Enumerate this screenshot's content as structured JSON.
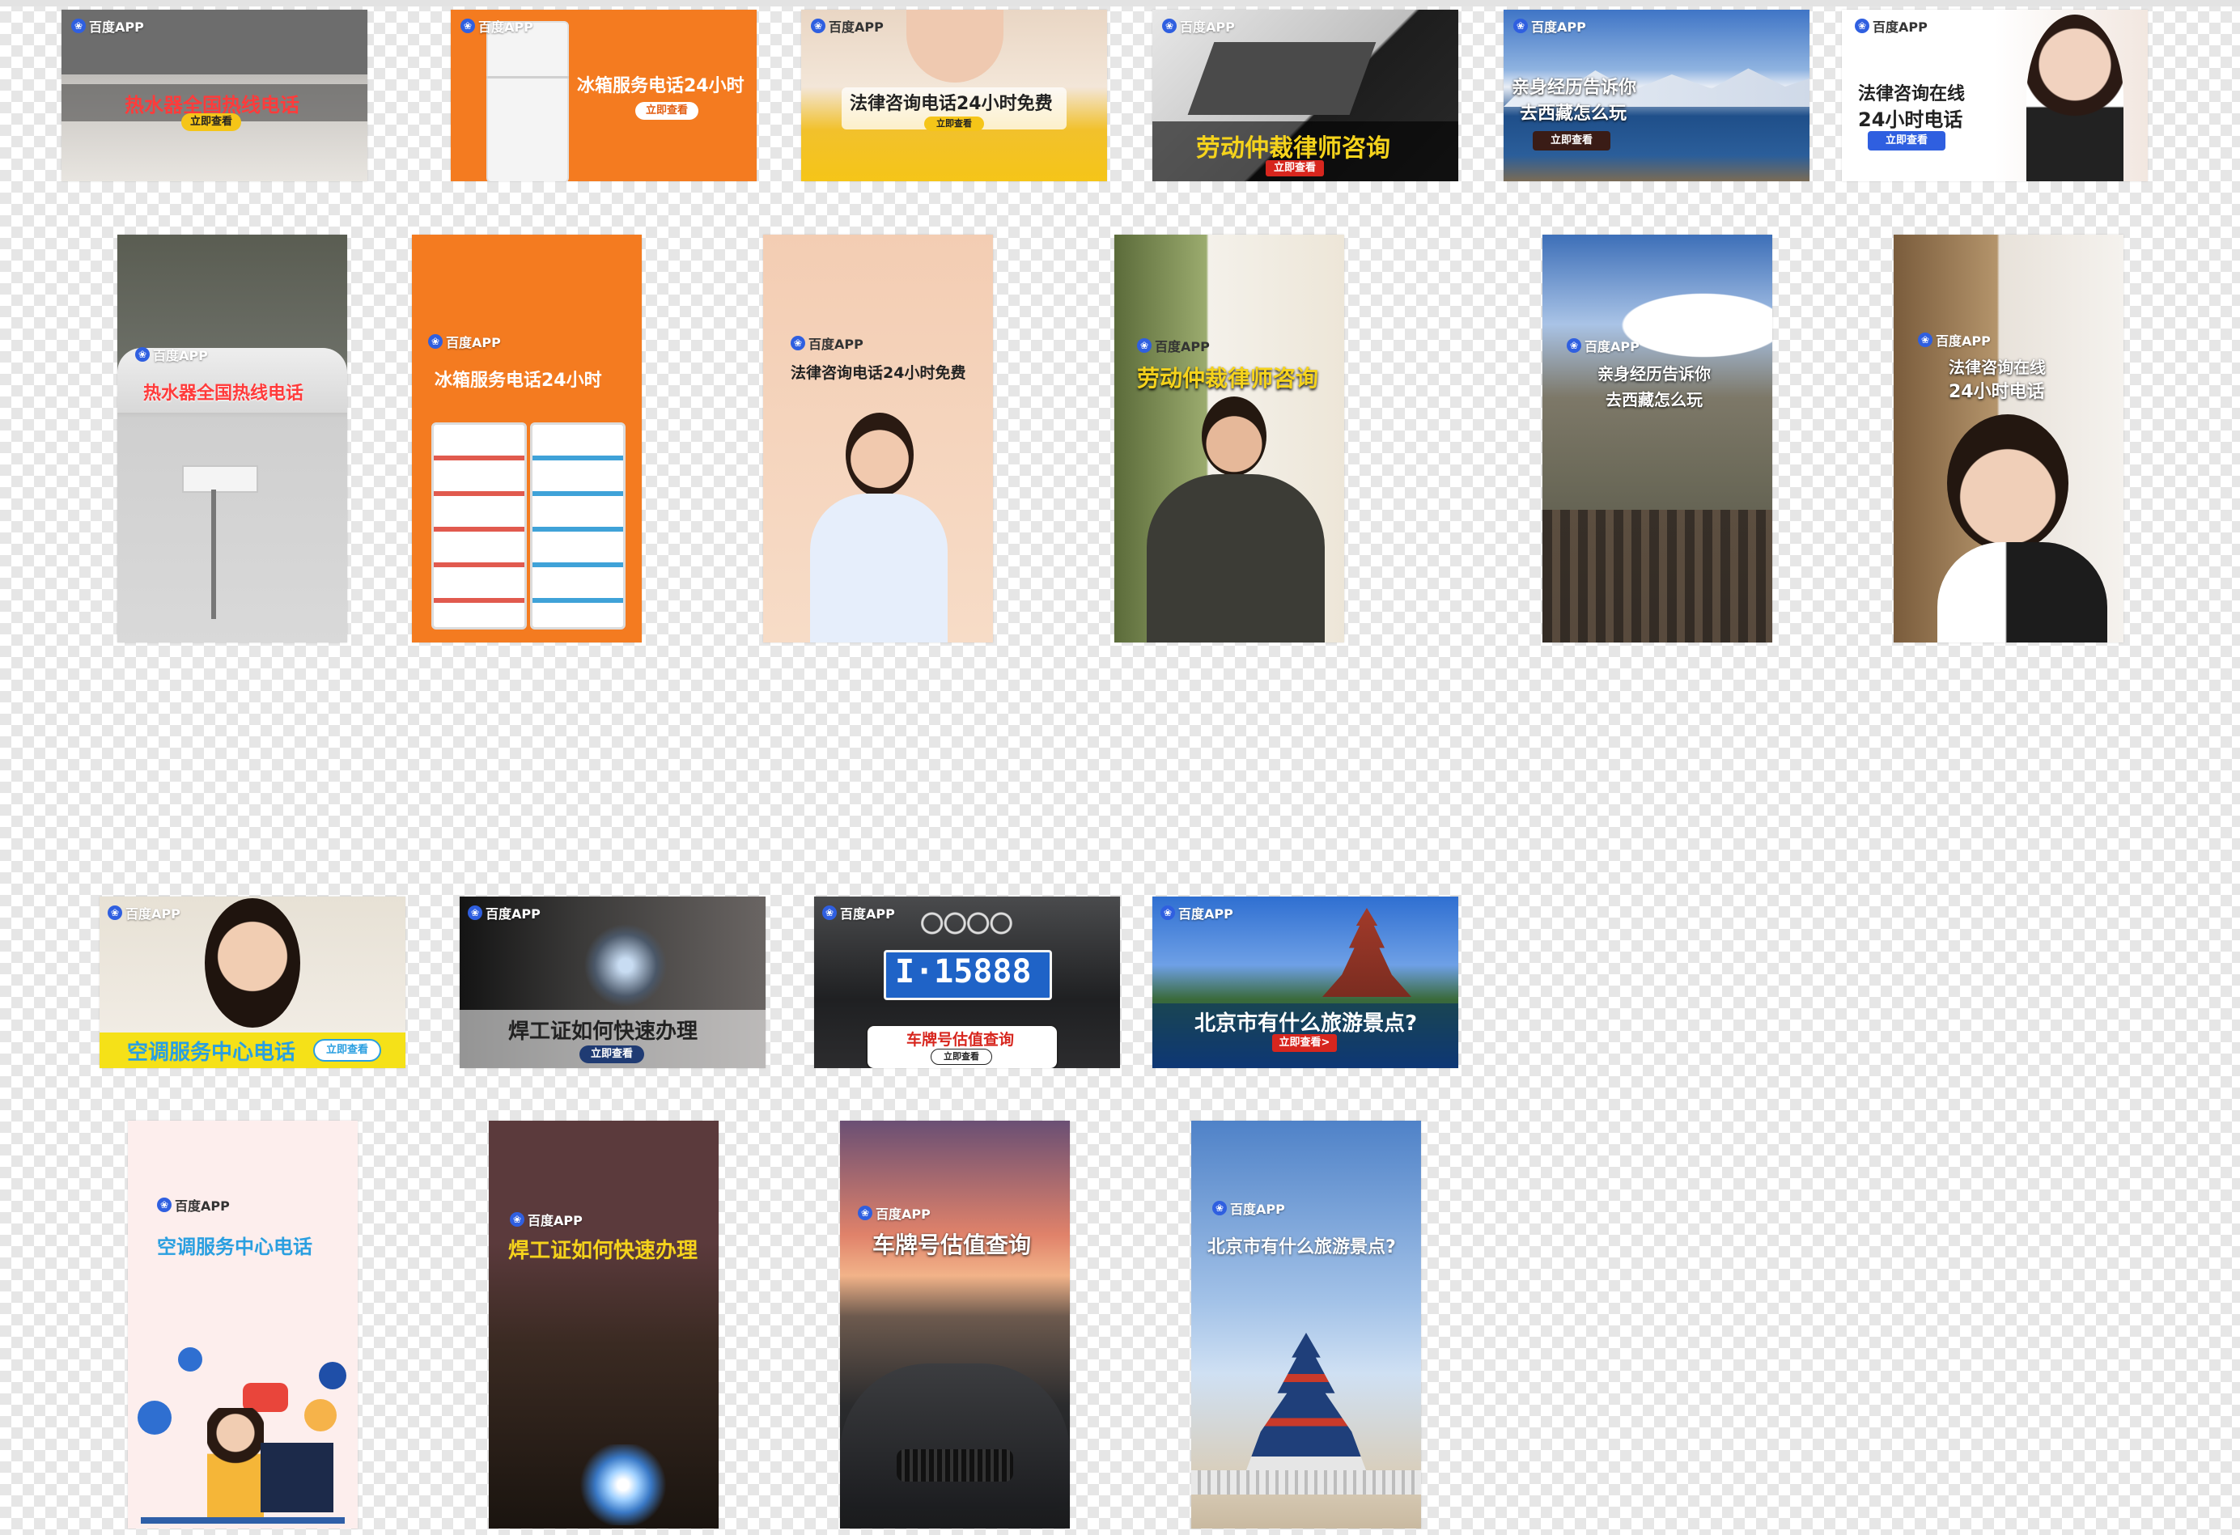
{
  "brand": "百度APP",
  "colors": {
    "baidu_blue": "#2f5fe0",
    "orange": "#f47b20",
    "yellow": "#f5c518",
    "red_button": "#d7261e"
  },
  "row1": [
    {
      "title": "热水器全国热线电话",
      "button": "立即查看"
    },
    {
      "title": "冰箱服务电话24小时",
      "button": "立即查看"
    },
    {
      "title": "法律咨询电话24小时免费",
      "button": "立即查看"
    },
    {
      "title": "劳动仲裁律师咨询",
      "button": "立即查看"
    },
    {
      "title_line1": "亲身经历告诉你",
      "title_line2": "去西藏怎么玩",
      "button": "立即查看"
    },
    {
      "title_line1": "法律咨询在线",
      "title_line2": "24小时电话",
      "button": "立即查看"
    }
  ],
  "row2": [
    {
      "title": "热水器全国热线电话"
    },
    {
      "title": "冰箱服务电话24小时"
    },
    {
      "title": "法律咨询电话24小时免费"
    },
    {
      "title": "劳动仲裁律师咨询"
    },
    {
      "title_line1": "亲身经历告诉你",
      "title_line2": "去西藏怎么玩"
    },
    {
      "title_line1": "法律咨询在线",
      "title_line2": "24小时电话"
    }
  ],
  "row3": [
    {
      "title": "空调服务中心电话",
      "button": "立即查看"
    },
    {
      "title": "焊工证如何快速办理",
      "button": "立即查看"
    },
    {
      "plate": "I·15888",
      "title": "车牌号估值查询",
      "button": "立即查看"
    },
    {
      "title": "北京市有什么旅游景点?",
      "button": "立即查看>"
    }
  ],
  "row4": [
    {
      "title": "空调服务中心电话"
    },
    {
      "title": "焊工证如何快速办理"
    },
    {
      "title": "车牌号估值查询"
    },
    {
      "title": "北京市有什么旅游景点?"
    }
  ]
}
